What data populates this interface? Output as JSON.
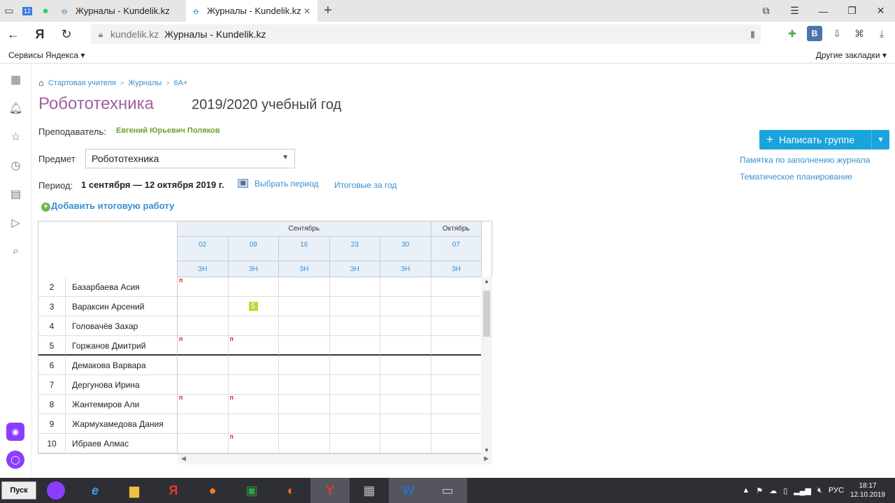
{
  "browser": {
    "tabs": [
      {
        "title": "Журналы - Kundelik.kz",
        "active": false
      },
      {
        "title": "Журналы - Kundelik.kz",
        "active": true
      }
    ],
    "pinned": [
      "12"
    ],
    "url_host": "kundelik.kz",
    "url_title": "Журналы - Kundelik.kz",
    "bookmarks_left": "Сервисы Яндекса ▾",
    "bookmarks_right": "Другие закладки ▾"
  },
  "page": {
    "breadcrumbs": [
      "Стартовая учителя",
      "Журналы",
      "6А+"
    ],
    "title": "Робототехника",
    "year": "2019/2020 учебный год",
    "teacher_label": "Преподаватель:",
    "teacher_name": "Евгений Юрьевич Поляков",
    "subject_label": "Предмет",
    "subject_value": "Робототехника",
    "period_label": "Период:",
    "period_value": "1 сентября — 12 октября 2019 г.",
    "choose_period": "Выбрать период",
    "year_totals": "Итоговые за год",
    "add_final": "Добавить итоговую работу",
    "write_group": "Написать группе",
    "memo_link": "Памятка по заполнению журнала",
    "thematic_link": "Тематическое планирование"
  },
  "journal": {
    "months": [
      {
        "name": "Сентябрь",
        "span": 5
      },
      {
        "name": "Октябрь",
        "span": 1
      }
    ],
    "days": [
      "02",
      "09",
      "16",
      "23",
      "30",
      "07"
    ],
    "types": [
      "ЗН",
      "ЗН",
      "ЗН",
      "ЗН",
      "ЗН",
      "ЗН"
    ],
    "students": [
      {
        "num": "2",
        "name": "Базарбаева Асия",
        "marks": [
          "п",
          "",
          "",
          "",
          "",
          ""
        ]
      },
      {
        "num": "3",
        "name": "Вараксин Арсений",
        "marks": [
          "",
          "5",
          "",
          "",
          "",
          ""
        ]
      },
      {
        "num": "4",
        "name": "Головачёв Захар",
        "marks": [
          "",
          "",
          "",
          "",
          "",
          ""
        ]
      },
      {
        "num": "5",
        "name": "Горжанов Дмитрий",
        "marks": [
          "п",
          "п",
          "",
          "",
          "",
          ""
        ]
      },
      {
        "num": "6",
        "name": "Демакова Варвара",
        "marks": [
          "",
          "",
          "",
          "",
          "",
          ""
        ]
      },
      {
        "num": "7",
        "name": "Дергунова Ирина",
        "marks": [
          "",
          "",
          "",
          "",
          "",
          ""
        ]
      },
      {
        "num": "8",
        "name": "Жантемиров Али",
        "marks": [
          "п",
          "п",
          "",
          "",
          "",
          ""
        ]
      },
      {
        "num": "9",
        "name": "Жармухамедова Дания",
        "marks": [
          "",
          "",
          "",
          "",
          "",
          ""
        ]
      },
      {
        "num": "10",
        "name": "Ибраев Алмас",
        "marks": [
          "",
          "п",
          "",
          "",
          "",
          ""
        ]
      }
    ]
  },
  "taskbar": {
    "start": "Пуск",
    "lang": "РУС",
    "time": "18:17",
    "date": "12.10.2019"
  }
}
